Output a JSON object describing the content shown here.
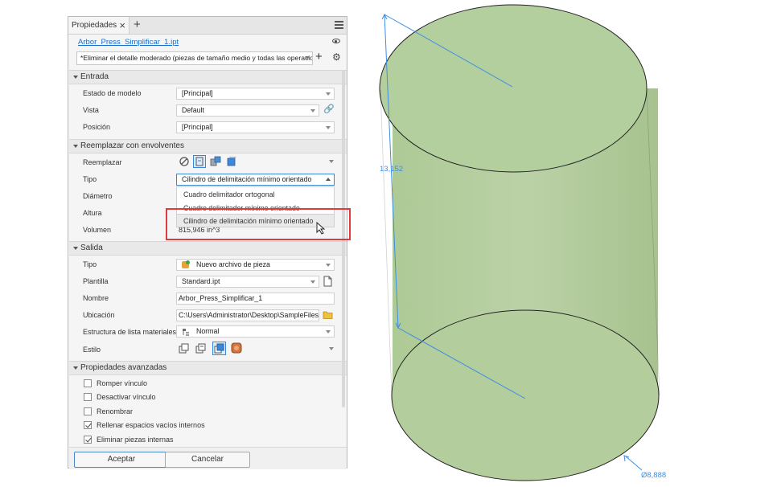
{
  "panel": {
    "tab_label": "Propiedades",
    "file_link": "Arbor_Press_Simplificar_1.ipt",
    "preset_value": "*Eliminar el detalle moderado (piezas de tamaño medio y todas las operaciones)"
  },
  "entrada": {
    "title": "Entrada",
    "rows": [
      {
        "label": "Estado de modelo",
        "value": "[Principal]"
      },
      {
        "label": "Vista",
        "value": "Default"
      },
      {
        "label": "Posición",
        "value": "[Principal]"
      }
    ]
  },
  "reemplazar": {
    "title": "Reemplazar con envolventes",
    "reemplazar_label": "Reemplazar",
    "tipo_label": "Tipo",
    "tipo_value": "Cilindro de delimitación mínimo orientado",
    "diametro_label": "Diámetro",
    "altura_label": "Altura",
    "volumen_label": "Volumen",
    "volumen_value": "815,946 in^3",
    "dropdown_options": [
      "Cuadro delimitador ortogonal",
      "Cuadro delimitador mínimo orientado",
      "Cilindro de delimitación mínimo orientado"
    ]
  },
  "salida": {
    "title": "Salida",
    "rows": [
      {
        "label": "Tipo",
        "value": "Nuevo archivo de pieza"
      },
      {
        "label": "Plantilla",
        "value": "Standard.ipt"
      },
      {
        "label": "Nombre",
        "value": "Arbor_Press_Simplificar_1"
      },
      {
        "label": "Ubicación",
        "value": "C:\\Users\\Administrator\\Desktop\\SampleFiles\\"
      },
      {
        "label": "Estructura de lista materiales",
        "value": "Normal"
      },
      {
        "label": "Estilo",
        "value": ""
      }
    ]
  },
  "avanzadas": {
    "title": "Propiedades avanzadas",
    "items": [
      {
        "label": "Romper vínculo",
        "checked": false
      },
      {
        "label": "Desactivar vínculo",
        "checked": false
      },
      {
        "label": "Renombrar",
        "checked": false
      },
      {
        "label": "Rellenar espacios vacíos internos",
        "checked": true
      },
      {
        "label": "Eliminar piezas internas",
        "checked": true
      }
    ]
  },
  "buttons": {
    "ok": "Aceptar",
    "cancel": "Cancelar"
  },
  "viewport": {
    "height_dim": "13,152",
    "diameter_dim": "Ø8,888",
    "cylinder_color": "#b5cf9f",
    "dimension_color": "#3e8ee6"
  },
  "colors": {
    "accent": "#1a6fc9",
    "highlight_box": "#e0393e"
  }
}
